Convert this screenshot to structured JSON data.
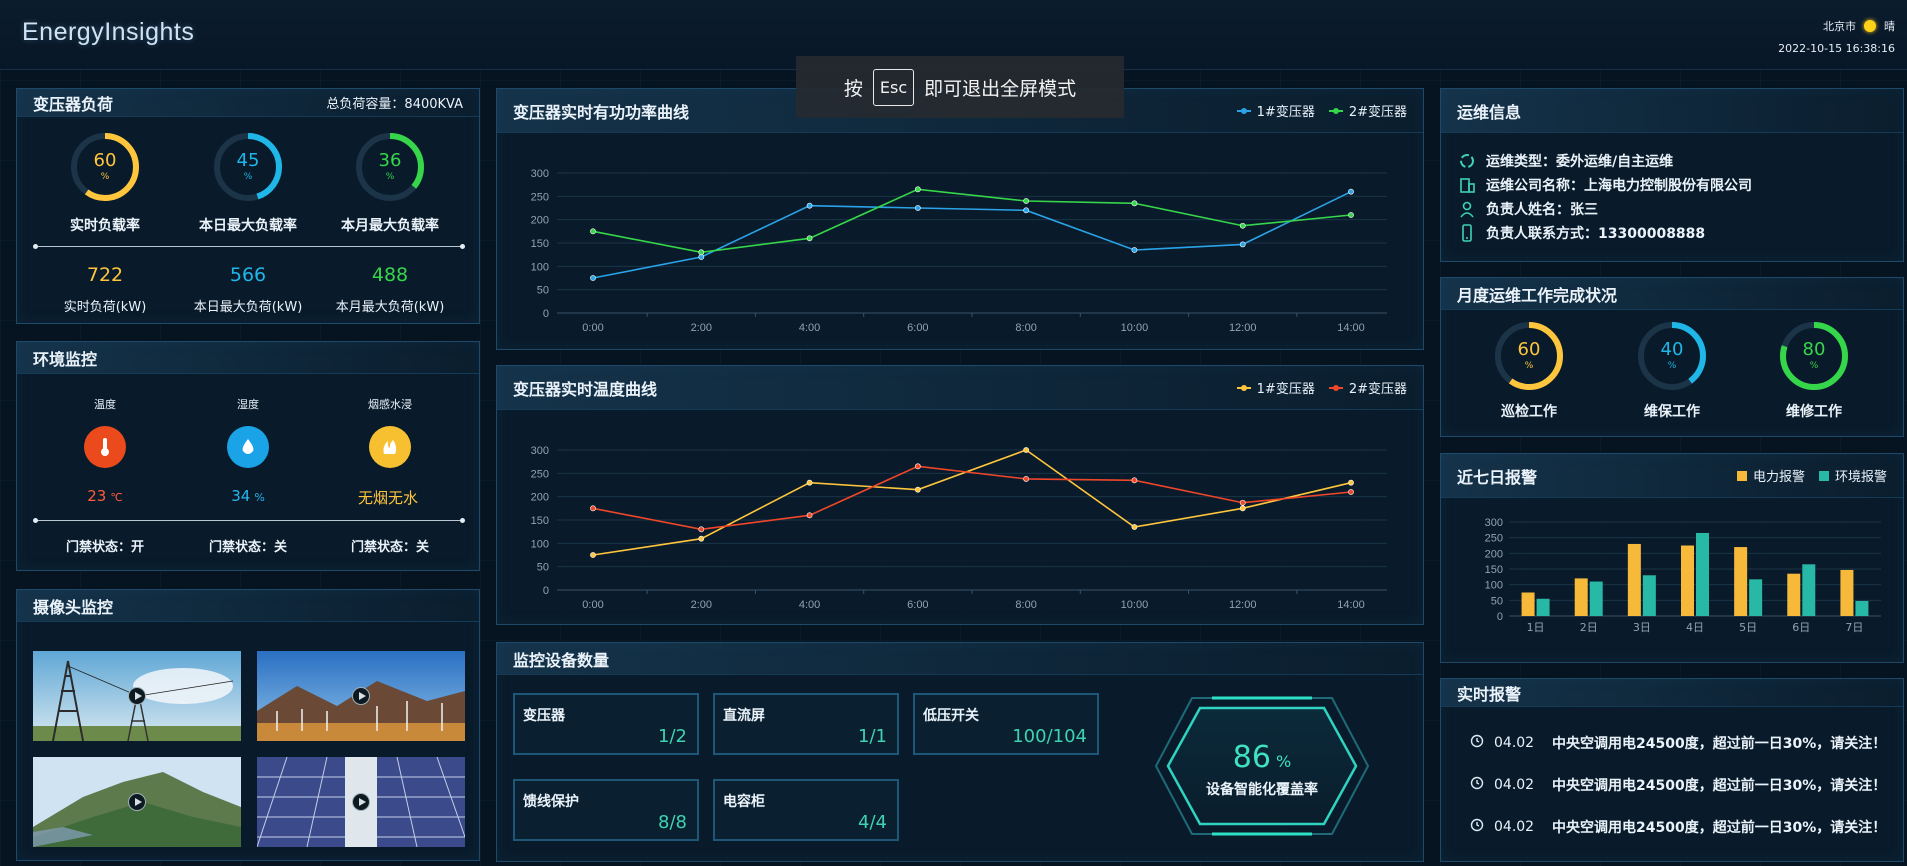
{
  "app": {
    "brand": "EnergyInsights"
  },
  "header": {
    "city": "北京市",
    "weather": "晴",
    "datetime": "2022-10-15 16:38:16"
  },
  "toast": {
    "prefix": "按",
    "key": "Esc",
    "suffix": "即可退出全屏模式"
  },
  "transformer_load": {
    "title": "变压器负荷",
    "capacity": "总负荷容量：8400KVA",
    "gauges": [
      {
        "value": "60",
        "unit": "%",
        "label": "实时负载率",
        "percent": 60,
        "color": "#ffc53d"
      },
      {
        "value": "45",
        "unit": "%",
        "label": "本日最大负载率",
        "percent": 45,
        "color": "#1fb6e8"
      },
      {
        "value": "36",
        "unit": "%",
        "label": "本月最大负载率",
        "percent": 36,
        "color": "#36d64b"
      }
    ],
    "stats": [
      {
        "value": "722",
        "label": "实时负荷(kW)",
        "color": "#ffc53d"
      },
      {
        "value": "566",
        "label": "本日最大负荷(kW)",
        "color": "#1fb6e8"
      },
      {
        "value": "488",
        "label": "本月最大负荷(kW)",
        "color": "#36d64b"
      }
    ]
  },
  "environment": {
    "title": "环境监控",
    "items": [
      {
        "label": "温度",
        "value": "23",
        "unit": "℃",
        "icon": "thermometer-icon",
        "bg": "#ea4a1c",
        "color": "#ff5a3a"
      },
      {
        "label": "湿度",
        "value": "34",
        "unit": "%",
        "icon": "water-drop-icon",
        "bg": "#1aa3e6",
        "color": "#23b6ef"
      },
      {
        "label": "烟感水浸",
        "value": "无烟无水",
        "unit": "",
        "icon": "smoke-water-icon",
        "bg": "#f7c030",
        "color": "#ffc53d"
      }
    ],
    "doors": [
      "门禁状态：开",
      "门禁状态：关",
      "门禁状态：关"
    ]
  },
  "cameras": {
    "title": "摄像头监控"
  },
  "power_chart": {
    "title": "变压器实时有功功率曲线",
    "legend": [
      "1#变压器",
      "2#变压器"
    ]
  },
  "temp_chart": {
    "title": "变压器实时温度曲线",
    "legend": [
      "1#变压器",
      "2#变压器"
    ]
  },
  "chart_data": [
    {
      "type": "line",
      "title": "变压器实时有功功率曲线",
      "x": [
        "0:00",
        "2:00",
        "4:00",
        "6:00",
        "8:00",
        "10:00",
        "12:00",
        "14:00"
      ],
      "yticks": [
        "0",
        "50",
        "100",
        "150",
        "200",
        "250",
        "300"
      ],
      "ylim": [
        0,
        300
      ],
      "grid": true,
      "legend_position": "top-right",
      "series": [
        {
          "name": "1#变压器",
          "color": "#2ba3e8",
          "values": [
            75,
            120,
            230,
            225,
            220,
            135,
            147,
            260
          ]
        },
        {
          "name": "2#变压器",
          "color": "#36d64b",
          "values": [
            175,
            130,
            160,
            265,
            240,
            235,
            187,
            210
          ]
        }
      ]
    },
    {
      "type": "line",
      "title": "变压器实时温度曲线",
      "x": [
        "0:00",
        "2:00",
        "4:00",
        "6:00",
        "8:00",
        "10:00",
        "12:00",
        "14:00"
      ],
      "yticks": [
        "0",
        "50",
        "100",
        "150",
        "200",
        "250",
        "300"
      ],
      "ylim": [
        0,
        300
      ],
      "grid": true,
      "legend_position": "top-right",
      "series": [
        {
          "name": "1#变压器",
          "color": "#ffc53d",
          "values": [
            75,
            110,
            230,
            215,
            300,
            135,
            175,
            230
          ]
        },
        {
          "name": "2#变压器",
          "color": "#f0462a",
          "values": [
            175,
            130,
            160,
            265,
            238,
            235,
            187,
            210
          ]
        }
      ]
    },
    {
      "type": "bar",
      "title": "近七日报警",
      "categories": [
        "1日",
        "2日",
        "3日",
        "4日",
        "5日",
        "6日",
        "7日"
      ],
      "yticks": [
        "0",
        "50",
        "100",
        "150",
        "200",
        "250",
        "300"
      ],
      "ylim": [
        0,
        300
      ],
      "grid": true,
      "legend_position": "top-right",
      "series": [
        {
          "name": "电力报警",
          "color": "#f7b93a",
          "values": [
            75,
            120,
            230,
            225,
            220,
            135,
            147
          ]
        },
        {
          "name": "环境报警",
          "color": "#27b8a6",
          "values": [
            55,
            110,
            130,
            265,
            117,
            165,
            48
          ]
        }
      ]
    }
  ],
  "devices": {
    "title": "监控设备数量",
    "items": [
      {
        "name": "变压器",
        "value": "1/2"
      },
      {
        "name": "直流屏",
        "value": "1/1"
      },
      {
        "name": "低压开关",
        "value": "100/104"
      },
      {
        "name": "馈线保护",
        "value": "8/8"
      },
      {
        "name": "电容柜",
        "value": "4/4"
      }
    ],
    "coverage": {
      "value": "86",
      "unit": "%",
      "label": "设备智能化覆盖率"
    }
  },
  "maintenance": {
    "title": "运维信息",
    "rows": [
      {
        "icon": "recycle-icon",
        "text": "运维类型：委外运维/自主运维"
      },
      {
        "icon": "building-icon",
        "text": "运维公司名称：上海电力控制股份有限公司"
      },
      {
        "icon": "person-icon",
        "text": "负责人姓名：张三"
      },
      {
        "icon": "phone-icon",
        "text": "负责人联系方式：13300008888"
      }
    ]
  },
  "monthly": {
    "title": "月度运维工作完成状况",
    "gauges": [
      {
        "value": "60",
        "unit": "%",
        "label": "巡检工作",
        "percent": 60,
        "color": "#ffc53d"
      },
      {
        "value": "40",
        "unit": "%",
        "label": "维保工作",
        "percent": 40,
        "color": "#1fb6e8"
      },
      {
        "value": "80",
        "unit": "%",
        "label": "维修工作",
        "percent": 80,
        "color": "#36d64b"
      }
    ]
  },
  "alarms7": {
    "title": "近七日报警",
    "legend": [
      "电力报警",
      "环境报警"
    ]
  },
  "realtime": {
    "title": "实时报警",
    "items": [
      {
        "date": "04.02",
        "text": "中央空调用电24500度，超过前一日30%，请关注！"
      },
      {
        "date": "04.02",
        "text": "中央空调用电24500度，超过前一日30%，请关注！"
      },
      {
        "date": "04.02",
        "text": "中央空调用电24500度，超过前一日30%，请关注！"
      }
    ]
  }
}
